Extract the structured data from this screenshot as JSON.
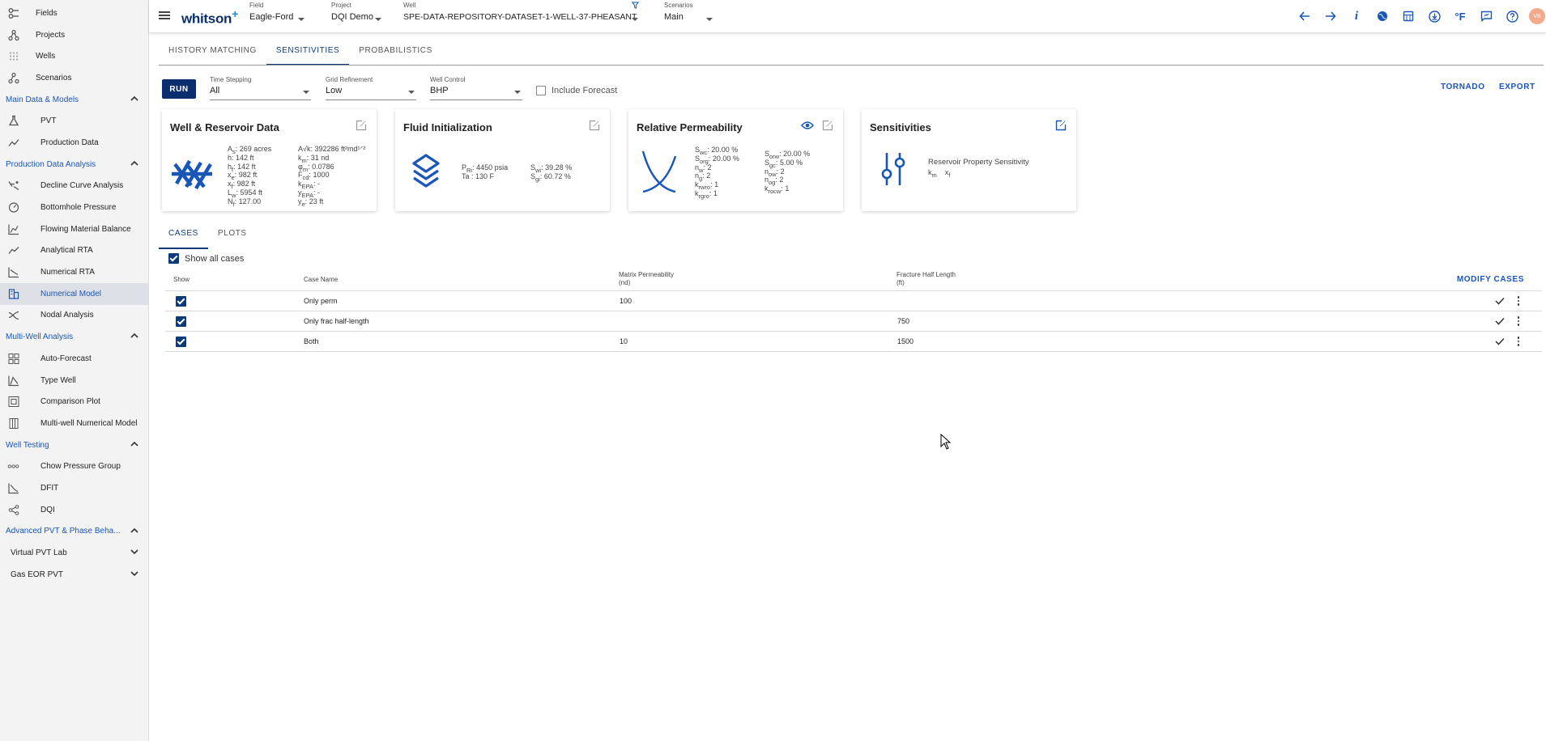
{
  "sidebar": {
    "top_items": [
      {
        "label": "Fields",
        "icon": "fields-icon"
      },
      {
        "label": "Projects",
        "icon": "projects-icon"
      },
      {
        "label": "Wells",
        "icon": "wells-icon"
      },
      {
        "label": "Scenarios",
        "icon": "scenarios-icon"
      }
    ],
    "sections": {
      "main_data": {
        "label": "Main Data & Models",
        "items": [
          {
            "label": "PVT"
          },
          {
            "label": "Production Data"
          }
        ]
      },
      "production_analysis": {
        "label": "Production Data Analysis",
        "items": [
          {
            "label": "Decline Curve Analysis"
          },
          {
            "label": "Bottomhole Pressure"
          },
          {
            "label": "Flowing Material Balance"
          },
          {
            "label": "Analytical RTA"
          },
          {
            "label": "Numerical RTA"
          },
          {
            "label": "Numerical Model"
          },
          {
            "label": "Nodal Analysis"
          }
        ]
      },
      "multi_well": {
        "label": "Multi-Well Analysis",
        "items": [
          {
            "label": "Auto-Forecast"
          },
          {
            "label": "Type Well"
          },
          {
            "label": "Comparison Plot"
          },
          {
            "label": "Multi-well Numerical Model"
          }
        ]
      },
      "well_testing": {
        "label": "Well Testing",
        "items": [
          {
            "label": "Chow Pressure Group"
          },
          {
            "label": "DFIT"
          },
          {
            "label": "DQI"
          }
        ]
      },
      "advanced_pvt": {
        "label": "Advanced PVT & Phase Beha..."
      },
      "virtual_pvt": {
        "label": "Virtual PVT Lab"
      },
      "gas_eor": {
        "label": "Gas EOR PVT"
      }
    }
  },
  "topbar": {
    "logo": "whitson",
    "logo_plus": "+",
    "field": {
      "caption": "Field",
      "value": "Eagle-Ford"
    },
    "project": {
      "caption": "Project",
      "value": "DQI Demo"
    },
    "well": {
      "caption": "Well",
      "value": "SPE-DATA-REPOSITORY-DATASET-1-WELL-37-PHEASANT"
    },
    "scenario": {
      "caption": "Scenarios",
      "value": "Main"
    },
    "temp_unit": "°F",
    "info_glyph": "i",
    "avatar_initials": "VB"
  },
  "main": {
    "tabs": [
      "HISTORY MATCHING",
      "SENSITIVITIES",
      "PROBABILISTICS"
    ],
    "active_tab": "SENSITIVITIES",
    "run_label": "RUN",
    "time_stepping": {
      "caption": "Time Stepping",
      "value": "All"
    },
    "grid_refinement": {
      "caption": "Grid Refinement",
      "value": "Low"
    },
    "well_control": {
      "caption": "Well Control",
      "value": "BHP"
    },
    "include_forecast": "Include Forecast",
    "tornado": "TORNADO",
    "export": "EXPORT"
  },
  "cards": {
    "well_reservoir": {
      "title": "Well & Reservoir Data",
      "left": [
        "269 acres",
        "142 ft",
        "142 ft",
        "982 ft",
        "982 ft",
        "5954 ft",
        "127.00"
      ],
      "right": [
        "392286 ft²md¹ᐟ²",
        "31 nd",
        "0.0786",
        "1000",
        "-",
        "-",
        "23 ft"
      ]
    },
    "fluid_init": {
      "title": "Fluid Initialization",
      "pri": "4450 psia",
      "ta": "130 F",
      "swi": "39.28 %",
      "sgi": "60.72 %"
    },
    "rel_perm": {
      "title": "Relative Permeability",
      "left": [
        "20.00 %",
        "20.00 %",
        "2",
        "2",
        "1",
        "1"
      ],
      "right": [
        "20.00 %",
        "5.00 %",
        "2",
        "2",
        "1"
      ]
    },
    "sensitivities": {
      "title": "Sensitivities",
      "subtitle": "Reservoir Property Sensitivity",
      "vars": "km    xf"
    }
  },
  "sub_tabs": [
    "CASES",
    "PLOTS"
  ],
  "active_sub_tab": "CASES",
  "cases": {
    "show_all": "Show all cases",
    "headers": {
      "show": "Show",
      "case_name": "Case Name",
      "matrix_perm": "Matrix Permeability",
      "matrix_perm_unit": "(nd)",
      "frac_half": "Fracture Half Length",
      "frac_half_unit": "(ft)"
    },
    "modify": "MODIFY CASES",
    "rows": [
      {
        "name": "Only perm",
        "perm": "100",
        "frac": ""
      },
      {
        "name": "Only frac half-length",
        "perm": "",
        "frac": "750"
      },
      {
        "name": "Both",
        "perm": "10",
        "frac": "1500"
      }
    ]
  },
  "colors": {
    "accent": "#1a56b8",
    "navy": "#0b2e6e",
    "sidebar_bg": "#f3f3f4"
  }
}
